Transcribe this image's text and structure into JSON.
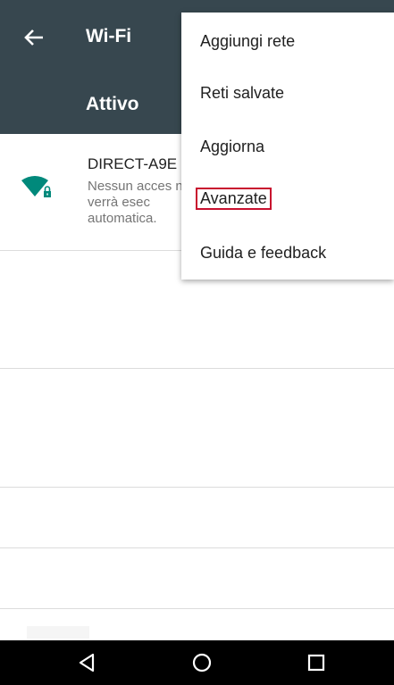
{
  "appbar": {
    "title": "Wi-Fi"
  },
  "section": {
    "title": "Attivo"
  },
  "network": {
    "name": "DIRECT-A9E",
    "description": "Nessun acces non verrà esec automatica.",
    "icon": "wifi-locked-icon"
  },
  "menu": {
    "items": [
      {
        "label": "Aggiungi rete"
      },
      {
        "label": "Reti salvate"
      },
      {
        "label": "Aggiorna"
      },
      {
        "label": "Avanzate",
        "highlighted": true
      },
      {
        "label": "Guida e feedback"
      }
    ]
  },
  "navbar": {
    "back_icon": "back-triangle-icon",
    "home_icon": "home-circle-icon",
    "recents_icon": "recents-square-icon"
  },
  "colors": {
    "appbar": "#37474f",
    "wifi_icon": "#00897b",
    "highlight_border": "#c8102e"
  }
}
